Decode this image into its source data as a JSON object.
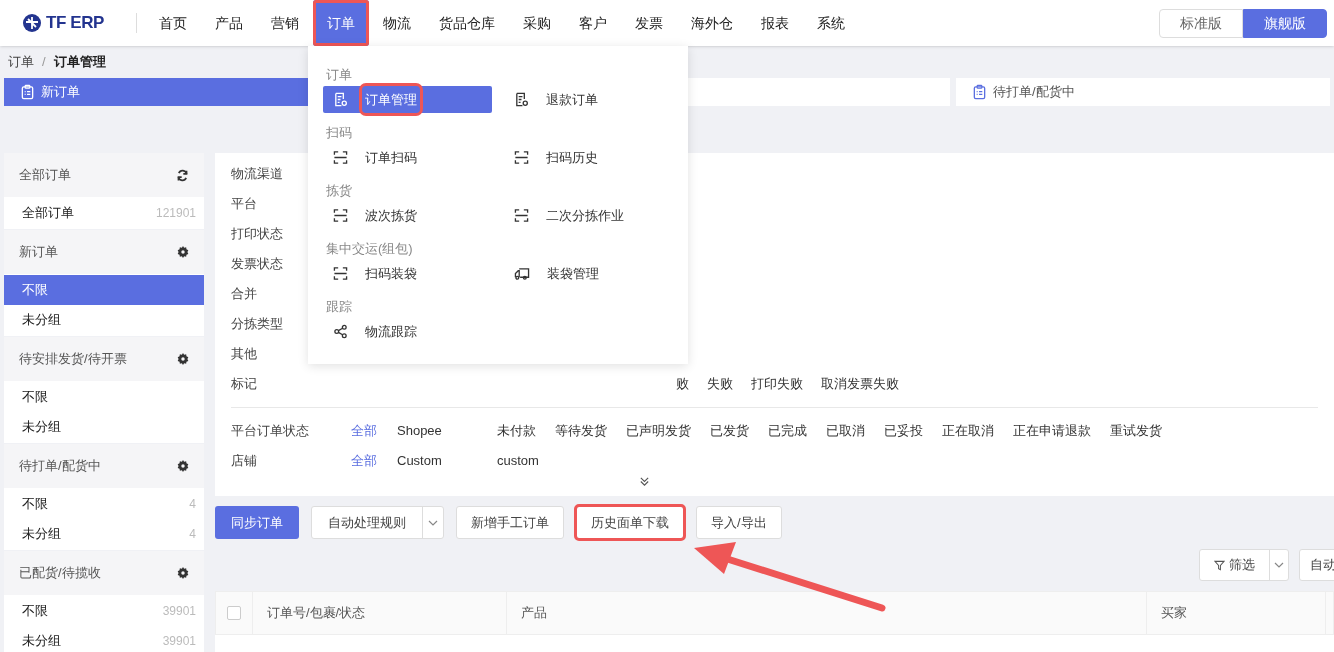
{
  "logo": {
    "text": "TF ERP"
  },
  "nav": [
    {
      "label": "首页",
      "selected": false,
      "highlighted": false
    },
    {
      "label": "产品",
      "selected": false,
      "highlighted": false
    },
    {
      "label": "营销",
      "selected": false,
      "highlighted": false
    },
    {
      "label": "订单",
      "selected": true,
      "highlighted": true
    },
    {
      "label": "物流",
      "selected": false,
      "highlighted": false
    },
    {
      "label": "货品仓库",
      "selected": false,
      "highlighted": false
    },
    {
      "label": "采购",
      "selected": false,
      "highlighted": false
    },
    {
      "label": "客户",
      "selected": false,
      "highlighted": false
    },
    {
      "label": "发票",
      "selected": false,
      "highlighted": false
    },
    {
      "label": "海外仓",
      "selected": false,
      "highlighted": false
    },
    {
      "label": "报表",
      "selected": false,
      "highlighted": false
    },
    {
      "label": "系统",
      "selected": false,
      "highlighted": false
    }
  ],
  "editions": [
    {
      "label": "标准版",
      "selected": false
    },
    {
      "label": "旗舰版",
      "selected": true
    }
  ],
  "breadcrumb": [
    "订单",
    "/",
    "订单管理"
  ],
  "steps": [
    {
      "label": "新订单",
      "selected": true
    },
    {
      "selected": false
    },
    {
      "label": "待打单/配货中",
      "selected": false
    }
  ],
  "sidebar": [
    {
      "title": "全部订单",
      "kind": "refresh",
      "items": [
        {
          "label": "全部订单",
          "count": "121901",
          "selected": false
        }
      ]
    },
    {
      "title": "新订单",
      "kind": "settings",
      "items": [
        {
          "label": "不限",
          "selected": true
        },
        {
          "label": "未分组",
          "selected": false
        }
      ]
    },
    {
      "title": "待安排发货/待开票",
      "kind": "settings",
      "items": [
        {
          "label": "不限",
          "selected": false
        },
        {
          "label": "未分组",
          "selected": false
        }
      ]
    },
    {
      "title": "待打单/配货中",
      "kind": "settings",
      "items": [
        {
          "label": "不限",
          "count": "4",
          "selected": false
        },
        {
          "label": "未分组",
          "count": "4",
          "selected": false
        }
      ]
    },
    {
      "title": "已配货/待揽收",
      "kind": "settings",
      "items": [
        {
          "label": "不限",
          "count": "39901",
          "selected": false
        },
        {
          "label": "未分组",
          "count": "39901",
          "selected": false
        }
      ]
    }
  ],
  "filters": [
    {
      "label": "物流渠道"
    },
    {
      "label": "平台"
    },
    {
      "label": "打印状态"
    },
    {
      "label": "发票状态"
    },
    {
      "label": "合并"
    },
    {
      "label": "分拣类型"
    },
    {
      "label": "其他"
    },
    {
      "label": "标记",
      "options": [
        "败",
        "失败",
        "打印失败",
        "取消发票失败"
      ]
    }
  ],
  "status_filters": [
    {
      "label": "平台订单状态",
      "all": "全部",
      "group": "Shopee",
      "options": [
        "未付款",
        "等待发货",
        "已声明发货",
        "已发货",
        "已完成",
        "已取消",
        "已妥投",
        "正在取消",
        "正在申请退款",
        "重试发货"
      ]
    },
    {
      "label": "店铺",
      "all": "全部",
      "group": "Custom",
      "options": [
        "custom"
      ]
    }
  ],
  "actions": [
    {
      "label": "同步订单",
      "kind": "primary",
      "highlighted": false
    },
    {
      "label": "自动处理规则",
      "kind": "split",
      "highlighted": false
    },
    {
      "label": "新增手工订单",
      "kind": "plain",
      "highlighted": false
    },
    {
      "label": "历史面单下载",
      "kind": "plain",
      "highlighted": true
    },
    {
      "label": "导入/导出",
      "kind": "plain",
      "highlighted": false
    }
  ],
  "secondary_actions": [
    {
      "label": "筛选",
      "kind": "filter"
    },
    {
      "label": "自动",
      "kind": "plain"
    }
  ],
  "table": {
    "select_all_checked": false,
    "columns": [
      "订单号/包裹/状态",
      "产品",
      "买家"
    ]
  },
  "menu": {
    "sections": [
      {
        "title": "订单",
        "items": [
          {
            "label": "订单管理",
            "kind": "document",
            "selected": true,
            "highlighted": true
          },
          {
            "label": "退款订单",
            "kind": "document",
            "selected": false,
            "highlighted": false
          }
        ]
      },
      {
        "title": "扫码",
        "items": [
          {
            "label": "订单扫码",
            "kind": "scan",
            "selected": false,
            "highlighted": false
          },
          {
            "label": "扫码历史",
            "kind": "scan",
            "selected": false,
            "highlighted": false
          }
        ]
      },
      {
        "title": "拣货",
        "items": [
          {
            "label": "波次拣货",
            "kind": "scan",
            "selected": false,
            "highlighted": false
          },
          {
            "label": "二次分拣作业",
            "kind": "scan",
            "selected": false,
            "highlighted": false
          }
        ]
      },
      {
        "title": "集中交运(组包)",
        "items": [
          {
            "label": "扫码装袋",
            "kind": "scan",
            "selected": false,
            "highlighted": false
          },
          {
            "label": "装袋管理",
            "kind": "delivery",
            "selected": false,
            "highlighted": false
          }
        ]
      },
      {
        "title": "跟踪",
        "items": [
          {
            "label": "物流跟踪",
            "kind": "tracking",
            "selected": false,
            "highlighted": false
          }
        ]
      }
    ]
  }
}
